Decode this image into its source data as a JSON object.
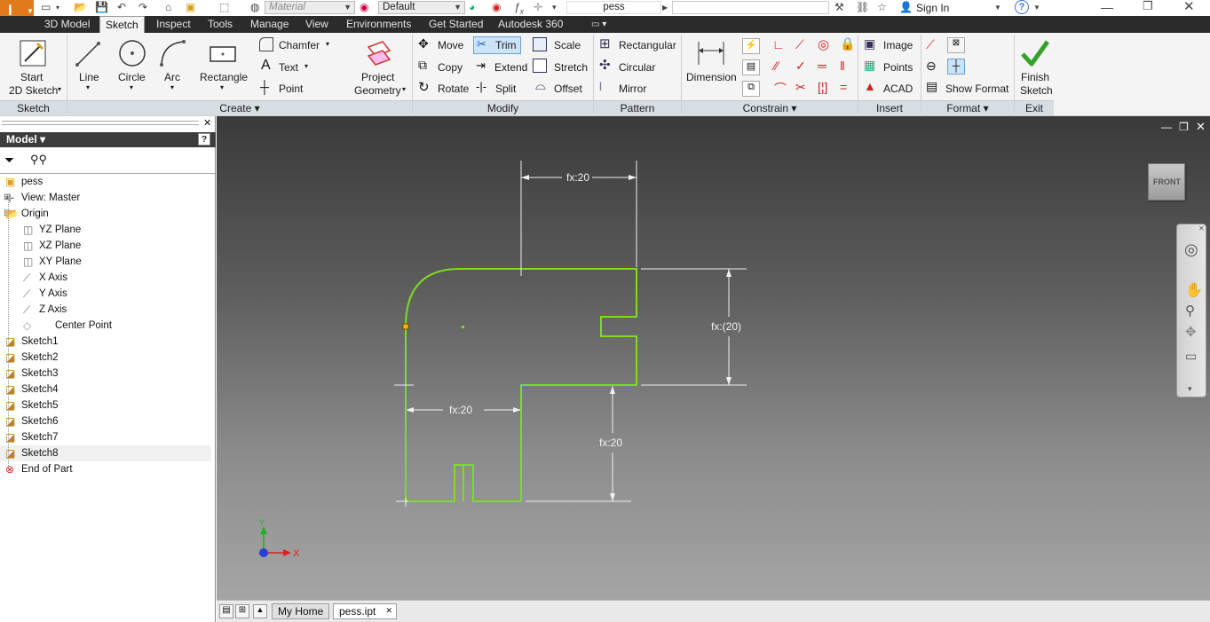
{
  "app": {
    "search_box": "pess",
    "sign_in": "Sign In",
    "help": "?"
  },
  "quick_access": {
    "material": "Material",
    "appearance": "Default"
  },
  "tabs": [
    "3D Model",
    "Sketch",
    "Inspect",
    "Tools",
    "Manage",
    "View",
    "Environments",
    "Get Started",
    "Autodesk 360"
  ],
  "ribbon": {
    "sketch": {
      "start_line1": "Start",
      "start_line2": "2D Sketch",
      "panel": "Sketch"
    },
    "create": {
      "line": "Line",
      "circle": "Circle",
      "arc": "Arc",
      "rectangle": "Rectangle",
      "chamfer": "Chamfer",
      "text": "Text",
      "point": "Point",
      "proj_line1": "Project",
      "proj_line2": "Geometry",
      "panel": "Create"
    },
    "modify": {
      "move": "Move",
      "trim": "Trim",
      "scale": "Scale",
      "copy": "Copy",
      "extend": "Extend",
      "stretch": "Stretch",
      "rotate": "Rotate",
      "split": "Split",
      "offset": "Offset",
      "panel": "Modify"
    },
    "pattern": {
      "rectangular": "Rectangular",
      "circular": "Circular",
      "mirror": "Mirror",
      "panel": "Pattern"
    },
    "constrain": {
      "dimension": "Dimension",
      "panel": "Constrain"
    },
    "insert": {
      "image": "Image",
      "points": "Points",
      "acad": "ACAD",
      "panel": "Insert"
    },
    "format": {
      "show_format": "Show Format",
      "panel": "Format"
    },
    "exit": {
      "finish_line1": "Finish",
      "finish_line2": "Sketch",
      "panel": "Exit"
    }
  },
  "browser": {
    "title": "Model",
    "items": [
      "pess",
      "View: Master",
      "Origin",
      "YZ Plane",
      "XZ Plane",
      "XY Plane",
      "X Axis",
      "Y Axis",
      "Z Axis",
      "Center Point",
      "Sketch1",
      "Sketch2",
      "Sketch3",
      "Sketch4",
      "Sketch5",
      "Sketch6",
      "Sketch7",
      "Sketch8",
      "End of Part"
    ]
  },
  "viewcube": {
    "face": "FRONT"
  },
  "dimensions": {
    "top": "fx:20",
    "right": "fx:(20)",
    "left": "fx:20",
    "bottom": "fx:20"
  },
  "triad": {
    "x": "X",
    "y": "Y"
  },
  "doc_tabs": {
    "home": "My Home",
    "file": "pess.ipt"
  },
  "colors": {
    "sketch_line": "#7ddc1f",
    "menu_bar": "#2b2b2b",
    "active_tab": "#f4f4f4",
    "triad_x": "#e02020",
    "triad_y": "#20b020"
  }
}
